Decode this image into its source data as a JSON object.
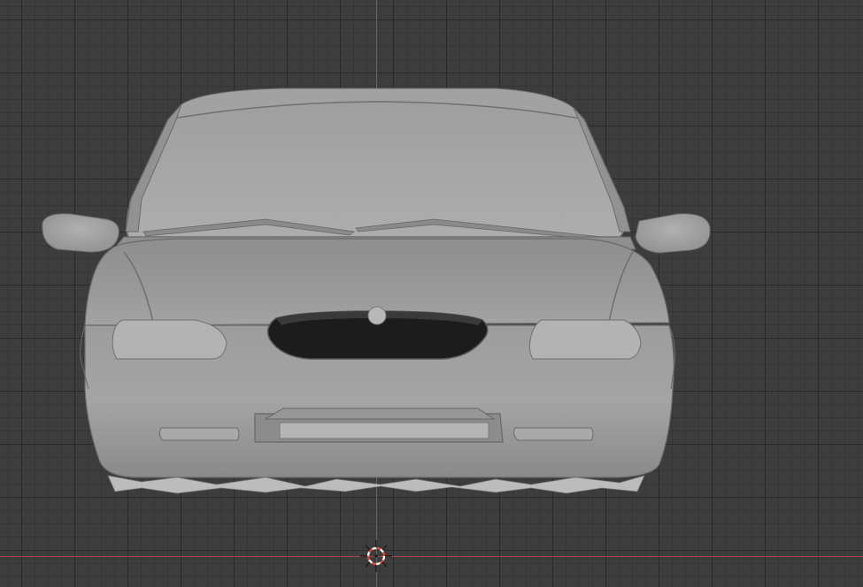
{
  "viewport": {
    "background_color": "#3d3d3d",
    "grid_color": "#353535",
    "axis_x_color": "#a14548",
    "axis_y_color": "#3d6fa8"
  },
  "model": {
    "icon": "car-front-mesh",
    "body_color": "#9a9a9a",
    "glass_color": "#a6a6a6",
    "grille_color": "#1c1c1c"
  },
  "cursor": {
    "icon": "3d-cursor-icon",
    "ring_colors": [
      "#d4473d",
      "#f2f2f2"
    ]
  }
}
